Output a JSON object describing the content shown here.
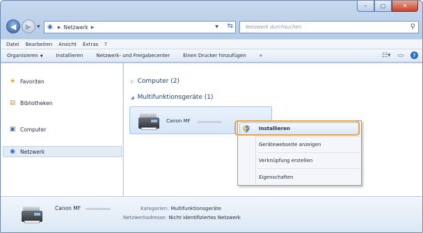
{
  "window": {
    "caption": {
      "minimize": "–",
      "maximize": "□",
      "close": "✕"
    }
  },
  "address": {
    "crumbs": [
      "Netzwerk"
    ],
    "search_placeholder": "Netzwerk durchsuchen"
  },
  "menubar": [
    "Datei",
    "Bearbeiten",
    "Ansicht",
    "Extras",
    "?"
  ],
  "toolbar": {
    "organize": "Organisieren",
    "install": "Installieren",
    "network_center": "Netzwerk- und Freigabecenter",
    "add_printer": "Einen Drucker hinzufügen",
    "more": "»"
  },
  "navpane": {
    "items": [
      {
        "label": "Favoriten",
        "icon": "star-icon"
      },
      {
        "label": "Bibliotheken",
        "icon": "library-icon"
      },
      {
        "label": "Computer",
        "icon": "computer-icon"
      },
      {
        "label": "Netzwerk",
        "icon": "network-icon"
      }
    ]
  },
  "content": {
    "groups": [
      {
        "label": "Computer (2)",
        "expanded": false
      },
      {
        "label": "Multifunktionsgeräte (1)",
        "expanded": true
      }
    ],
    "device": {
      "name": "Canon MF"
    }
  },
  "context_menu": {
    "items": [
      "Installieren",
      "Gerätewebseite anzeigen",
      "Verknüpfung erstellen",
      "Eigenschaften"
    ],
    "highlighted": "Installieren"
  },
  "details": {
    "name": "Canon MF",
    "category_label": "Kategorien:",
    "category_value": "Multifunktionsgeräte",
    "address_label": "Netzwerkadresse:",
    "address_value": "Nicht identifiziertes Netzwerk"
  },
  "colors": {
    "accent_ring": "#f0a33a",
    "selection": "#e3ebf6"
  }
}
